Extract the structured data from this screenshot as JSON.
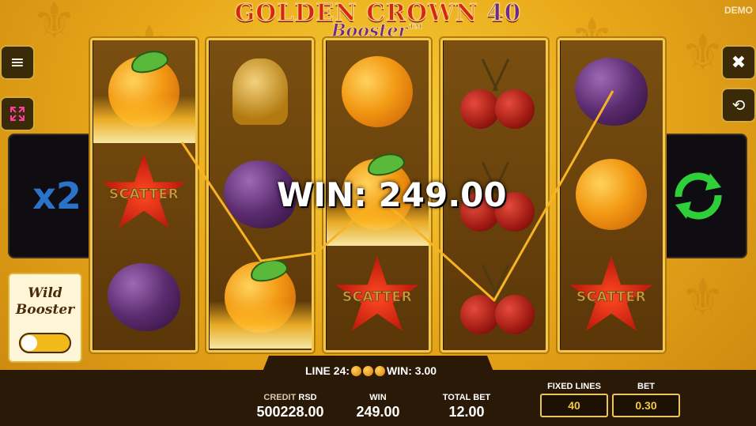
{
  "title": {
    "main": "GOLDEN CROWN",
    "number": "40",
    "sub": "Booster™"
  },
  "mode_badge": "DEMO",
  "buttons": {
    "menu_icon": "menu-icon",
    "fullscreen_icon": "fullscreen-icon",
    "close_icon": "close-icon",
    "history_icon": "history-icon",
    "spin_icon": "spin-icon"
  },
  "multiplier": "x2",
  "wild_booster": {
    "line1": "Wild",
    "line2": "Booster",
    "enabled": true
  },
  "reels": [
    [
      "orange",
      "scatter",
      "plum"
    ],
    [
      "bell",
      "plum",
      "orange"
    ],
    [
      "orange",
      "orange",
      "scatter"
    ],
    [
      "cherry",
      "cherry",
      "cherry"
    ],
    [
      "plum",
      "orange",
      "scatter"
    ]
  ],
  "scatter_label": "SCATTER",
  "win_message": "WIN: 249.00",
  "line_info": {
    "prefix": "LINE 24:",
    "symbol": "orange",
    "count": 3,
    "win": "WIN: 3.00"
  },
  "stats": {
    "credit_label": "CREDIT",
    "currency": "RSD",
    "credit_value": "500228.00",
    "win_label": "WIN",
    "win_value": "249.00",
    "total_bet_label": "TOTAL BET",
    "total_bet_value": "12.00",
    "fixed_lines_label": "FIXED LINES",
    "fixed_lines_value": "40",
    "bet_label": "BET",
    "bet_value": "0.30"
  },
  "colors": {
    "accent_gold": "#f2c84a",
    "spin_green": "#2fcf3a",
    "multiplier_blue": "#2a73c9"
  }
}
